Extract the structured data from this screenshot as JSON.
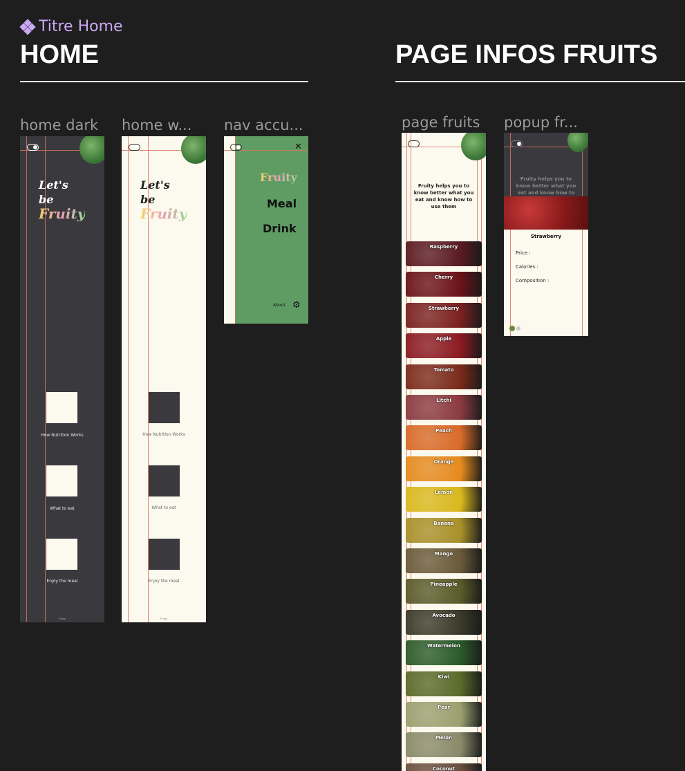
{
  "component_label": "Titre Home",
  "sections": {
    "home": {
      "title": "HOME"
    },
    "infos": {
      "title": "PAGE INFOS FRUITS"
    }
  },
  "frames": {
    "home_dark": {
      "label": "home dark",
      "hero": {
        "line1": "Let's",
        "line2": "be",
        "line3": "Fruity"
      },
      "items": [
        "How Nutrition Works",
        "What to eat",
        "Enjoy the meal"
      ],
      "footer": "Fruity"
    },
    "home_white": {
      "label": "home w...",
      "hero": {
        "line1": "Let's",
        "line2": "be",
        "line3": "Fruity"
      },
      "items": [
        "How Nutrition Works",
        "What to eat",
        "Enjoy the meal"
      ],
      "footer": "Fruity"
    },
    "nav": {
      "label": "nav accu...",
      "brand": "Fruity",
      "links": [
        "Meal",
        "Drink"
      ],
      "about": "About",
      "close_icon": "close-icon",
      "settings_icon": "gear-icon"
    },
    "page_fruits": {
      "label": "page fruits",
      "intro": "Fruity helps you to know better what you eat and know how to use them",
      "fruits": [
        {
          "name": "Raspberry",
          "color": "#5a1a22"
        },
        {
          "name": "Cherry",
          "color": "#6a1218"
        },
        {
          "name": "Strawberry",
          "color": "#7a2020"
        },
        {
          "name": "Apple",
          "color": "#8a1a22"
        },
        {
          "name": "Tomato",
          "color": "#7a2a1a"
        },
        {
          "name": "Litchi",
          "color": "#8a3a40"
        },
        {
          "name": "Peach",
          "color": "#d86a28"
        },
        {
          "name": "Orange",
          "color": "#e58a1e"
        },
        {
          "name": "Lemon",
          "color": "#d9b81e"
        },
        {
          "name": "Banana",
          "color": "#a8902a"
        },
        {
          "name": "Mango",
          "color": "#6a5a3a"
        },
        {
          "name": "Pineapple",
          "color": "#5a5a2a"
        },
        {
          "name": "Avocado",
          "color": "#3a3a2a"
        },
        {
          "name": "Watermelon",
          "color": "#2a5a2a"
        },
        {
          "name": "Kiwi",
          "color": "#5a6a2a"
        },
        {
          "name": "Pear",
          "color": "#9aa070"
        },
        {
          "name": "Melon",
          "color": "#8a8a6a"
        },
        {
          "name": "Coconut",
          "color": "#6a5040"
        }
      ]
    },
    "popup": {
      "label": "popup fr...",
      "intro": "Fruity helps you to know better what you eat and know how to",
      "fruit_name": "Strawberry",
      "fields": [
        "Price :",
        "Calories :",
        "Composition :"
      ]
    }
  },
  "colors": {
    "canvas": "#1e1e1e",
    "dark_bg": "#3a393e",
    "cream": "#fcf9ee",
    "nav_green": "#5f9c64",
    "guide": "#d9735e",
    "component": "#c9a8f5"
  }
}
